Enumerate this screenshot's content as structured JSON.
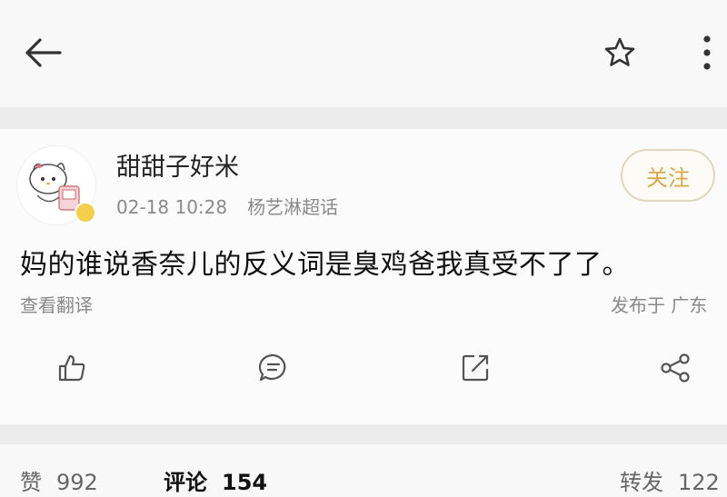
{
  "topbar": {
    "back_icon": "back-arrow-icon",
    "star_icon": "star-icon",
    "more_icon": "more-vertical-icon"
  },
  "post": {
    "author": "甜甜子好米",
    "date": "02-18 10:28",
    "topic": "杨艺淋超话",
    "follow_label": "关注",
    "content": "妈的谁说香奈儿的反义词是臭鸡爸我真受不了了。",
    "translate_label": "查看翻译",
    "location_label": "发布于 广东"
  },
  "actions": {
    "like_icon": "thumbs-up-icon",
    "comment_icon": "comment-icon",
    "repost_icon": "repost-icon",
    "share_icon": "share-icon"
  },
  "stats": {
    "likes_label": "赞",
    "likes_count": "992",
    "comments_label": "评论",
    "comments_count": "154",
    "reposts_label": "转发",
    "reposts_count": "122"
  },
  "colors": {
    "accent_gold": "#d9a848",
    "badge_gold": "#f3cf4c",
    "icon_gray": "#555555"
  }
}
